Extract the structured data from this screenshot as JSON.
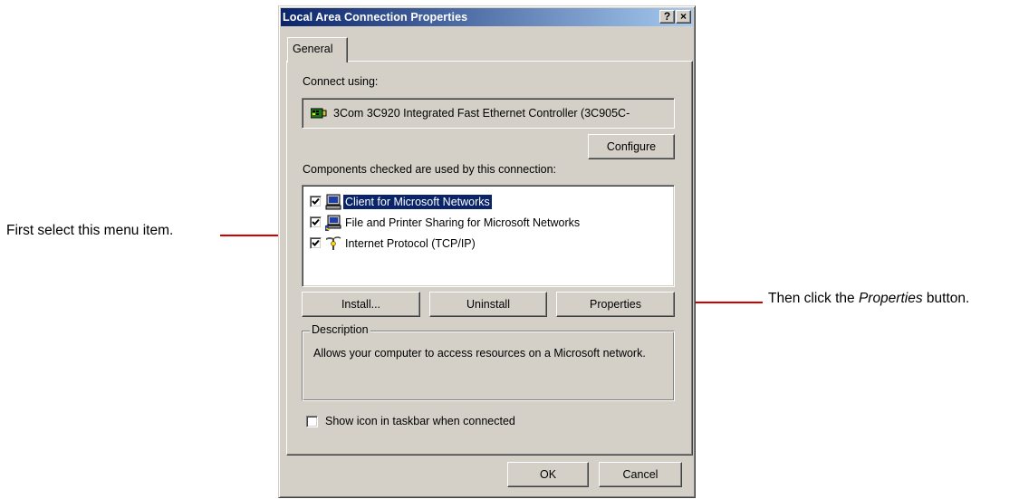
{
  "annotations": {
    "left_text": "First select this menu item.",
    "right_text_pre": "Then click the ",
    "right_text_em": "Properties",
    "right_text_post": " button."
  },
  "colors": {
    "annotation_line": "#d40000",
    "titlebar_start": "#0a246a",
    "titlebar_end": "#a6caf0",
    "dialog_face": "#d4d0c8",
    "selection": "#0a246a"
  },
  "dialog": {
    "title": "Local Area Connection Properties",
    "title_buttons": {
      "help": "?",
      "close": "×"
    },
    "tabs": [
      {
        "label": "General",
        "active": true
      }
    ],
    "connect_using_label": "Connect using:",
    "adapter": {
      "icon": "network-adapter-icon",
      "name": "3Com 3C920 Integrated Fast Ethernet Controller (3C905C-"
    },
    "configure_button": "Configure",
    "components_label": "Components checked are used by this connection:",
    "components": [
      {
        "label": "Client for Microsoft Networks",
        "checked": true,
        "selected": true,
        "icon": "network-client-icon"
      },
      {
        "label": "File and Printer Sharing for Microsoft Networks",
        "checked": true,
        "selected": false,
        "icon": "file-printer-sharing-icon"
      },
      {
        "label": "Internet Protocol (TCP/IP)",
        "checked": true,
        "selected": false,
        "icon": "network-protocol-icon"
      }
    ],
    "buttons": {
      "install": "Install...",
      "uninstall": "Uninstall",
      "properties": "Properties"
    },
    "description": {
      "legend": "Description",
      "text": "Allows your computer to access resources on a Microsoft network."
    },
    "show_icon_checkbox": {
      "label": "Show icon in taskbar when connected",
      "checked": false
    },
    "ok_button": "OK",
    "cancel_button": "Cancel"
  }
}
